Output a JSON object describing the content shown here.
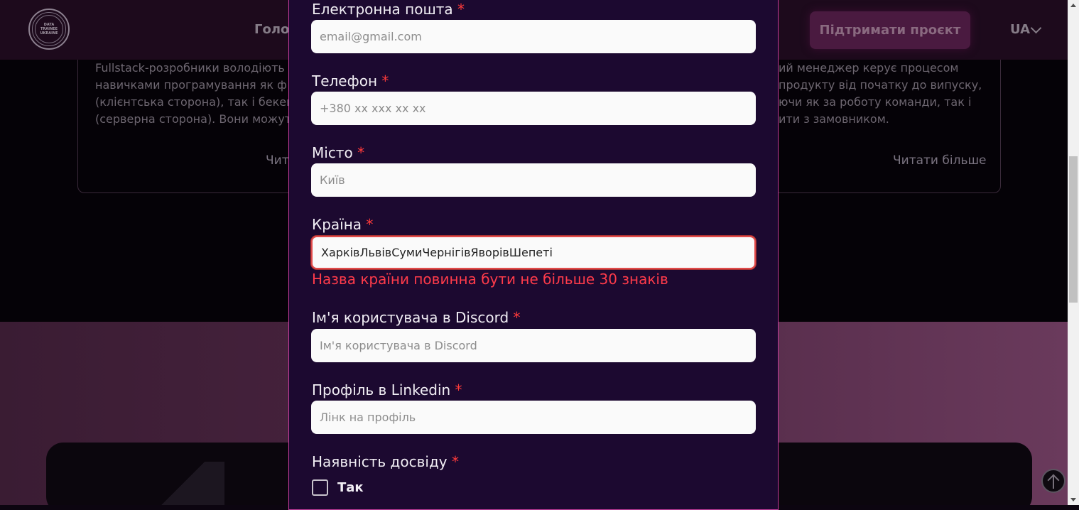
{
  "header": {
    "logo_text": "DATA TRAINEE UKRAINE",
    "nav_home": "Голов",
    "support_button": "Підтримати проєкт",
    "language": "UA"
  },
  "background": {
    "left_card_text": "Fullstack-розробники володіють навичками програмування як ф (клієнтська сторона), так і бекен (серверна сторона). Вони можут",
    "right_card_text": "ий менеджер керує процесом продукту від початку до випуску, ючи як за роботу команди, так і ити з замовником.",
    "read_more_left": "Чит",
    "read_more_right": "Читати більше"
  },
  "form": {
    "email": {
      "label": "Електронна пошта",
      "placeholder": "email@gmail.com",
      "value": ""
    },
    "phone": {
      "label": "Телефон",
      "placeholder": "+380 xx xxx xx xx",
      "value": ""
    },
    "city": {
      "label": "Місто",
      "placeholder": "Київ",
      "value": ""
    },
    "country": {
      "label": "Країна",
      "value": "ХарківЛьвівСумиЧернігівЯворівШепеті",
      "error": "Назва країни повинна бути не більше 30 знаків"
    },
    "discord": {
      "label": "Ім'я користувача в Discord",
      "placeholder": "Ім'я користувача в Discord",
      "value": ""
    },
    "linkedin": {
      "label": "Профіль в Linkedin",
      "placeholder": "Лінк на профіль",
      "value": ""
    },
    "experience": {
      "label": "Наявність досвіду",
      "option_yes": "Так"
    },
    "required_mark": "*"
  },
  "colors": {
    "modal_bg": "#1c0930",
    "modal_border": "#c33c9c",
    "error": "#ff3b4a",
    "required": "#ff3b3b"
  }
}
